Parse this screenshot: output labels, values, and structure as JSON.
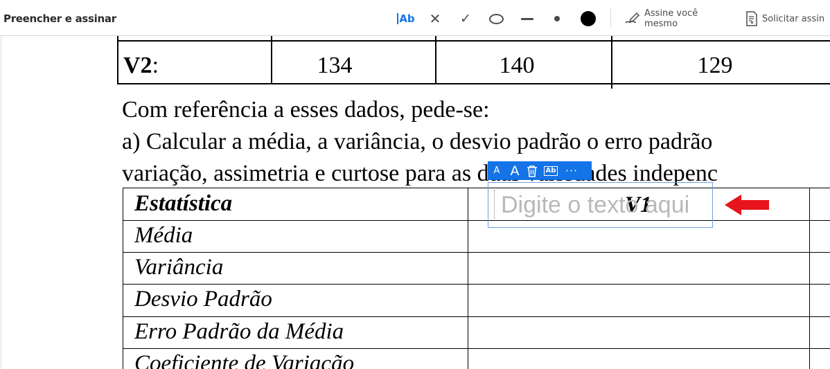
{
  "toolbar": {
    "title": "Preencher e assinar",
    "text_tool_label": "Ab",
    "sign_label": "Assine você mesmo",
    "request_label": "Solicitar assin",
    "color_hex": "#000000"
  },
  "document": {
    "top_table": {
      "row_label_bold": "V2",
      "row_label_suffix": ":",
      "values": [
        "134",
        "140",
        "129"
      ]
    },
    "paragraph": {
      "line1": "Com referência a esses dados, pede-se:",
      "line2": "a) Calcular a média, a variância, o desvio padrão o erro padrão",
      "line3": "variação, assimetria e curtose para as duas variedades indepenc"
    },
    "stats_table": {
      "header": "Estatística",
      "v1_header": "V1",
      "rows": [
        "Média",
        "Variância",
        "Desvio Padrão",
        "Erro Padrão da Média",
        "Coeficiente de Variação"
      ]
    },
    "field_toolbar": {
      "small_a": "A",
      "big_a": "A",
      "ab": "Ab",
      "more": "···"
    },
    "text_field": {
      "placeholder": "Digite o texto aqui",
      "value": ""
    }
  },
  "colors": {
    "accent": "#1473e6",
    "arrow": "#e8141c",
    "field_border": "#6e9fe0"
  }
}
